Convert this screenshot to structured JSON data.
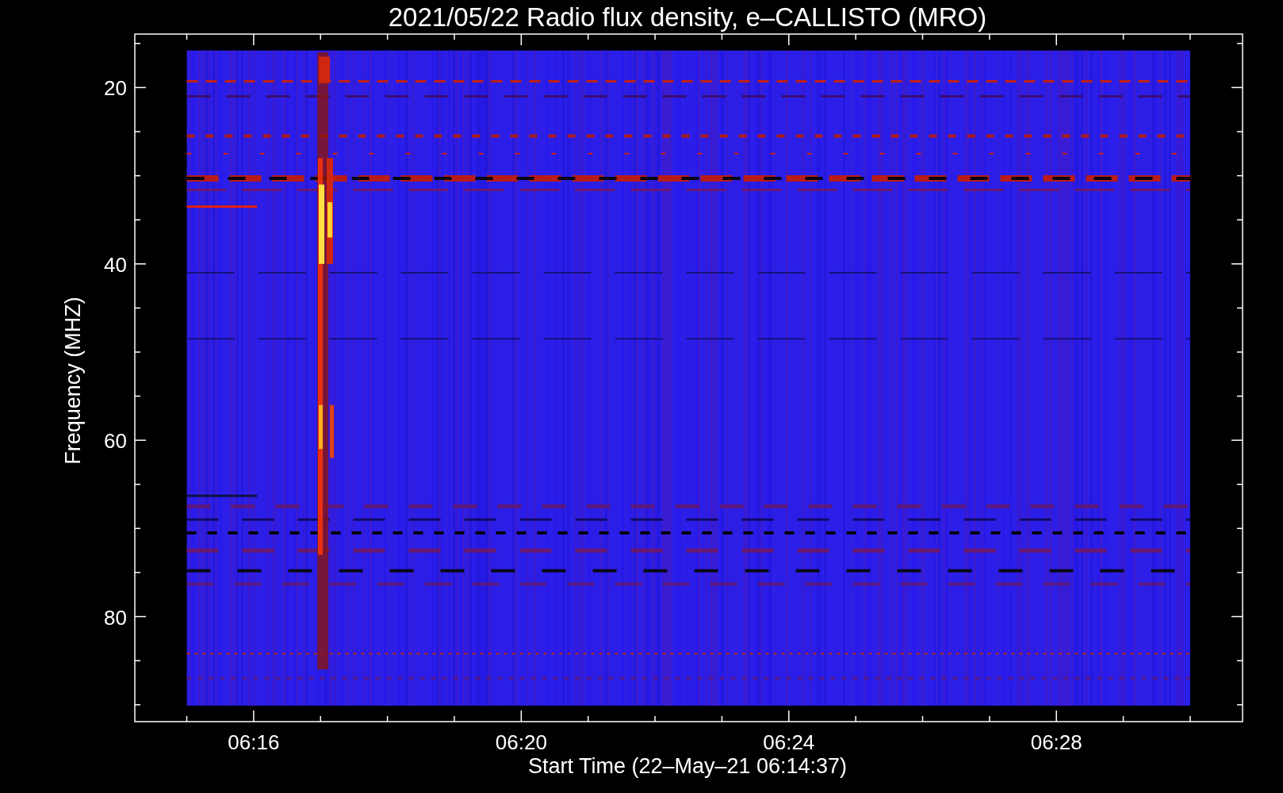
{
  "title": "2021/05/22  Radio flux density, e–CALLISTO (MRO)",
  "plot": {
    "kind": "spectrogram",
    "xlabel": "Start Time (22–May–21 06:14:37)",
    "ylabel": "Frequency (MHZ)",
    "xticks": [
      "06:16",
      "06:20",
      "06:24",
      "06:28"
    ],
    "yticks": [
      "20",
      "40",
      "60",
      "80"
    ]
  }
}
